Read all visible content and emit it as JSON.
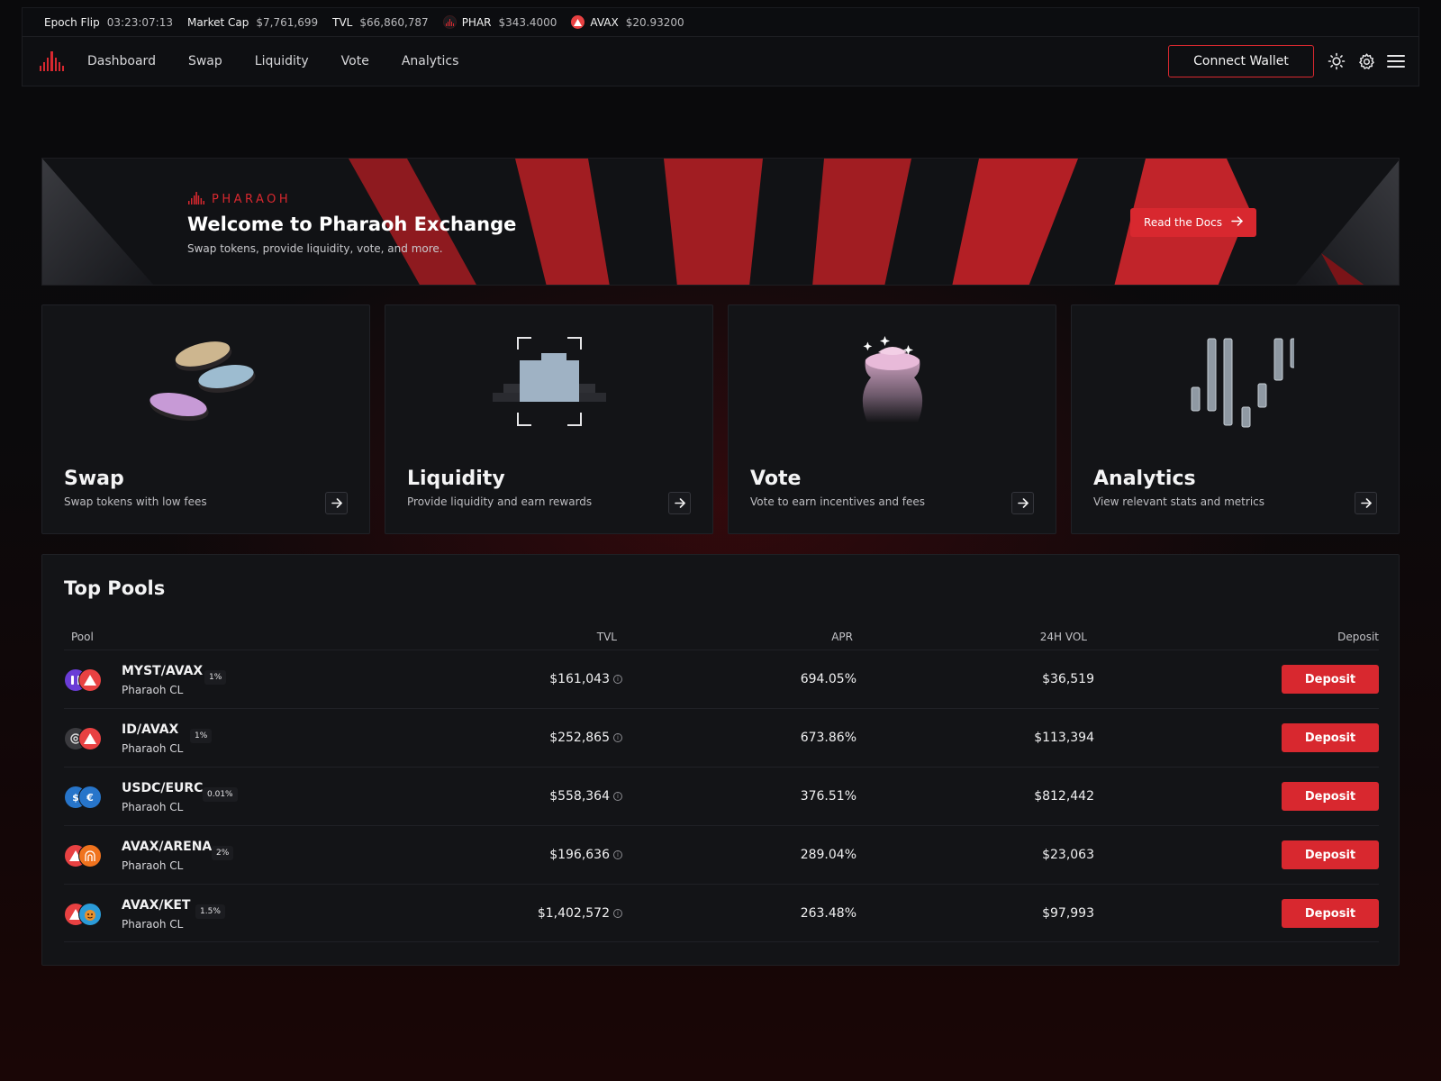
{
  "ticker": [
    {
      "label": "Epoch Flip",
      "value": "03:23:07:13",
      "icon": ""
    },
    {
      "label": "Market Cap",
      "value": "$7,761,699",
      "icon": ""
    },
    {
      "label": "TVL",
      "value": "$66,860,787",
      "icon": ""
    },
    {
      "label": "PHAR",
      "value": "$343.4000",
      "icon": "phar-token-icon"
    },
    {
      "label": "AVAX",
      "value": "$20.93200",
      "icon": "avax-token-icon"
    }
  ],
  "nav": {
    "links": [
      "Dashboard",
      "Swap",
      "Liquidity",
      "Vote",
      "Analytics"
    ],
    "connect_label": "Connect Wallet",
    "icons": [
      "sun-icon",
      "gear-icon",
      "menu-icon"
    ]
  },
  "banner": {
    "brand": "PHARAOH",
    "title": "Welcome to Pharaoh Exchange",
    "subtitle": "Swap tokens, provide liquidity, vote, and more.",
    "docs_label": "Read the Docs"
  },
  "cards": [
    {
      "title": "Swap",
      "desc": "Swap tokens with low fees",
      "art": "coins-illustration"
    },
    {
      "title": "Liquidity",
      "desc": "Provide liquidity and earn rewards",
      "art": "liquidity-illustration"
    },
    {
      "title": "Vote",
      "desc": "Vote to earn incentives and fees",
      "art": "vote-vase-illustration"
    },
    {
      "title": "Analytics",
      "desc": "View relevant stats and metrics",
      "art": "candlestick-illustration"
    }
  ],
  "pools": {
    "title": "Top Pools",
    "columns": [
      "Pool",
      "TVL",
      "APR",
      "24H VOL",
      "Deposit"
    ],
    "deposit_label": "Deposit",
    "rows": [
      {
        "name": "MYST/AVAX",
        "type": "Pharaoh CL",
        "fee": "1%",
        "tvl": "$161,043",
        "apr": "694.05%",
        "vol": "$36,519",
        "token_a": {
          "icon": "myst-token-icon",
          "color": "#6a3cd6"
        },
        "token_b": {
          "icon": "avax-token-icon",
          "color": "#e84142"
        }
      },
      {
        "name": "ID/AVAX",
        "type": "Pharaoh CL",
        "fee": "1%",
        "tvl": "$252,865",
        "apr": "673.86%",
        "vol": "$113,394",
        "token_a": {
          "icon": "id-token-icon",
          "color": "#3a3a3e"
        },
        "token_b": {
          "icon": "avax-token-icon",
          "color": "#e84142"
        }
      },
      {
        "name": "USDC/EURC",
        "type": "Pharaoh CL",
        "fee": "0.01%",
        "tvl": "$558,364",
        "apr": "376.51%",
        "vol": "$812,442",
        "token_a": {
          "icon": "usdc-token-icon",
          "color": "#2775ca"
        },
        "token_b": {
          "icon": "eurc-token-icon",
          "color": "#2775ca"
        }
      },
      {
        "name": "AVAX/ARENA",
        "type": "Pharaoh CL",
        "fee": "2%",
        "tvl": "$196,636",
        "apr": "289.04%",
        "vol": "$23,063",
        "token_a": {
          "icon": "avax-token-icon",
          "color": "#e84142"
        },
        "token_b": {
          "icon": "arena-token-icon",
          "color": "#f0731e"
        }
      },
      {
        "name": "AVAX/KET",
        "type": "Pharaoh CL",
        "fee": "1.5%",
        "tvl": "$1,402,572",
        "apr": "263.48%",
        "vol": "$97,993",
        "token_a": {
          "icon": "avax-token-icon",
          "color": "#e84142"
        },
        "token_b": {
          "icon": "ket-token-icon",
          "color": "#2b9bd8"
        }
      }
    ]
  },
  "colors": {
    "accent": "#d8282f",
    "panel": "#131417",
    "nav": "#0e0f12"
  }
}
